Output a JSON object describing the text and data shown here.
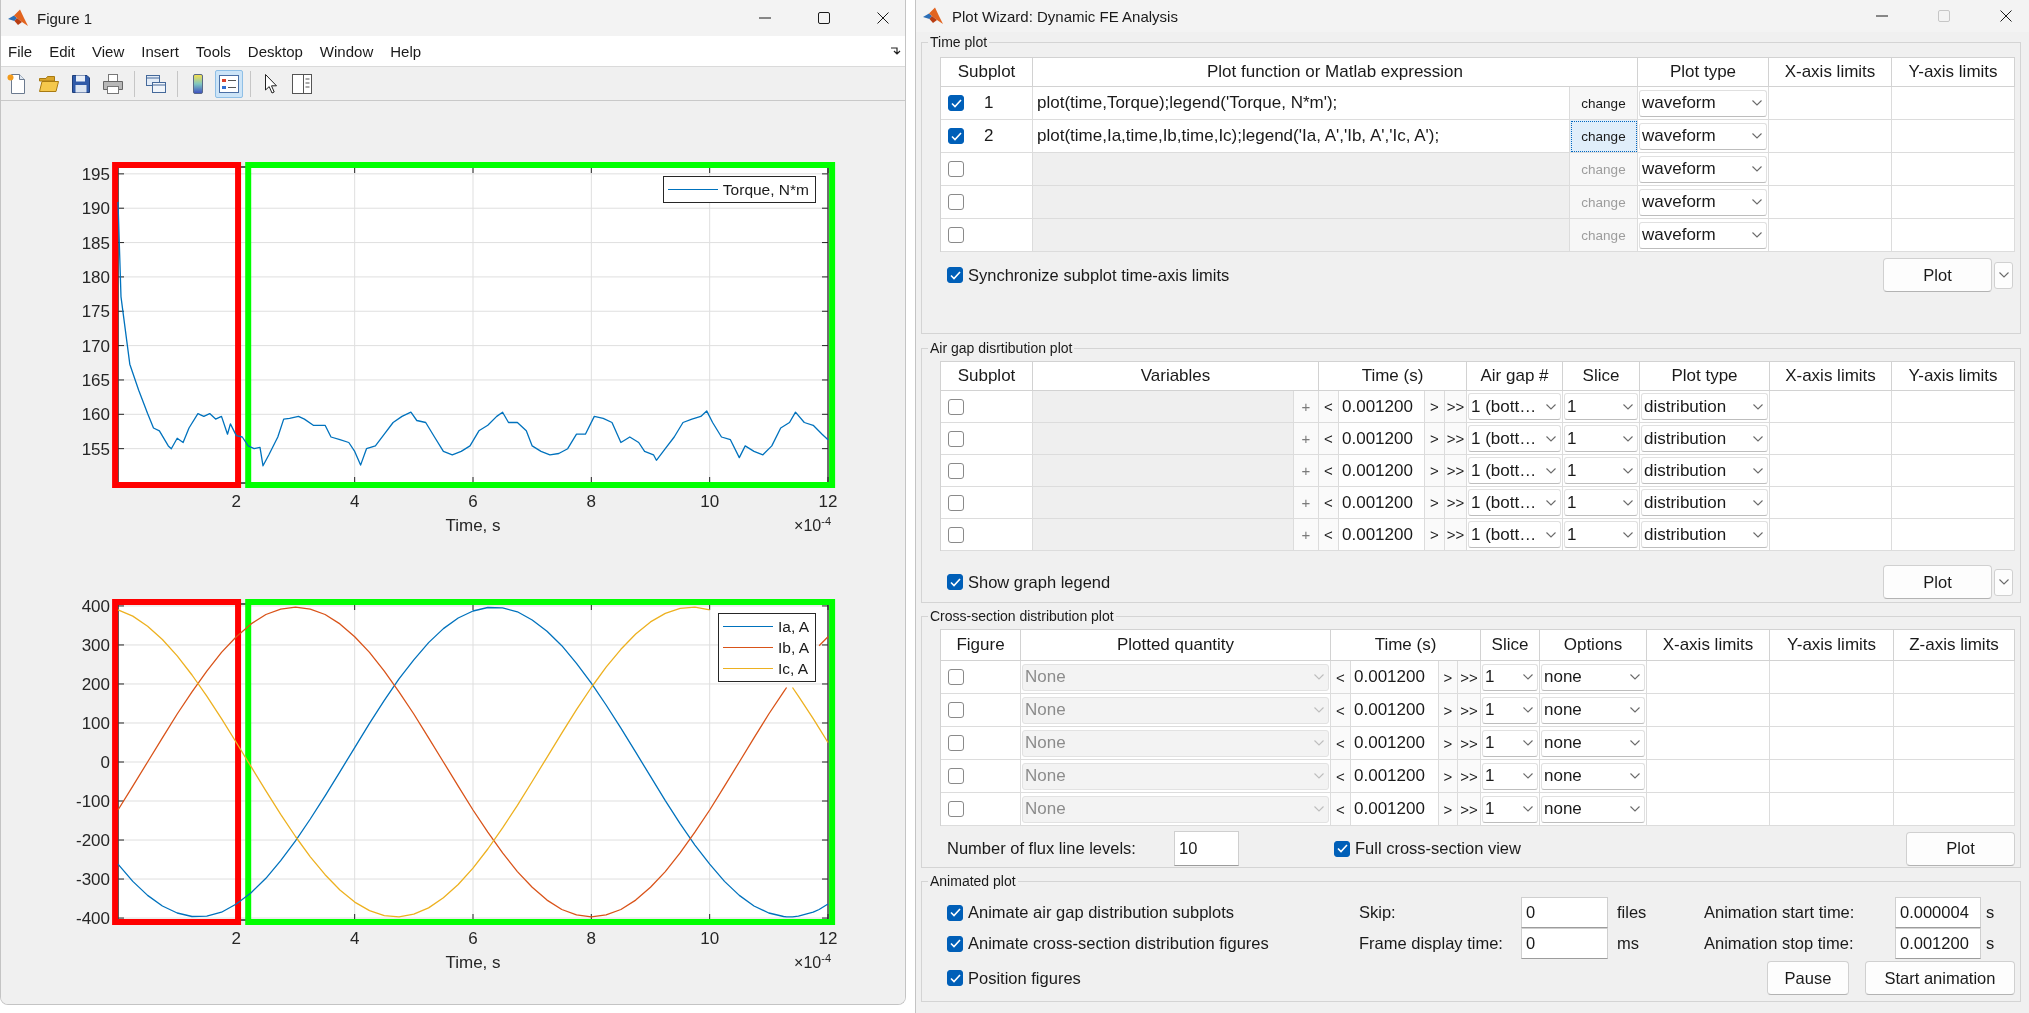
{
  "figure_window": {
    "title": "Figure 1",
    "window_controls": [
      {
        "kind": "minimize",
        "disabled": false
      },
      {
        "kind": "maximize",
        "disabled": false
      },
      {
        "kind": "close",
        "disabled": false
      }
    ],
    "menu": [
      "File",
      "Edit",
      "View",
      "Insert",
      "Tools",
      "Desktop",
      "Window",
      "Help"
    ],
    "toolbar": [
      [
        {
          "kind": "new",
          "selected": false
        },
        {
          "kind": "open",
          "selected": false
        },
        {
          "kind": "save",
          "selected": false
        },
        {
          "kind": "print",
          "selected": false
        }
      ],
      [
        {
          "kind": "link",
          "selected": false
        }
      ],
      [
        {
          "kind": "colorbar",
          "selected": false
        },
        {
          "kind": "legend",
          "selected": true
        }
      ],
      [
        {
          "kind": "pointer",
          "selected": false
        },
        {
          "kind": "inspector",
          "selected": false
        }
      ]
    ],
    "plots": [
      {
        "x_multiplier": "×10$^{-4}$",
        "highlights": [
          {
            "color": "#ff0000"
          },
          {
            "color": "#00ff00"
          }
        ],
        "chart_data": {
          "type": "line",
          "xlabel": "Time, s",
          "x": [
            0,
            0.05,
            0.2,
            0.35,
            0.5,
            0.6,
            0.7,
            0.85,
            0.9,
            1.0,
            1.1,
            1.2,
            1.35,
            1.45,
            1.55,
            1.65,
            1.75,
            1.85,
            1.9,
            2.0,
            2.1,
            2.2,
            2.3,
            2.4,
            2.45,
            2.55,
            2.7,
            2.8,
            2.9,
            3.05,
            3.15,
            3.3,
            3.5,
            3.6,
            3.75,
            3.9,
            4.0,
            4.1,
            4.2,
            4.35,
            4.5,
            4.65,
            4.8,
            4.95,
            5.05,
            5.2,
            5.35,
            5.5,
            5.65,
            5.8,
            5.95,
            6.1,
            6.25,
            6.4,
            6.5,
            6.6,
            6.75,
            6.9,
            7.0,
            7.15,
            7.3,
            7.45,
            7.6,
            7.75,
            7.9,
            8.05,
            8.2,
            8.35,
            8.5,
            8.65,
            8.8,
            8.9,
            9.05,
            9.1,
            9.25,
            9.4,
            9.55,
            9.7,
            9.85,
            9.95,
            10.05,
            10.2,
            10.35,
            10.5,
            10.6,
            10.75,
            10.9,
            11.05,
            11.2,
            11.35,
            11.45,
            11.6,
            11.75,
            11.9,
            12.0
          ],
          "series": [
            {
              "name": "Torque, N*m",
              "color": "#0072bd",
              "values": [
                190.9,
                177.1,
                167.3,
                163.5,
                160.1,
                158,
                157.6,
                155.4,
                155,
                156.5,
                155.9,
                158,
                160.1,
                159.7,
                160.1,
                159.3,
                159.7,
                157.1,
                158.6,
                156.9,
                156.7,
                155.4,
                155,
                155.2,
                152.5,
                154.1,
                156.7,
                159.3,
                159.4,
                159.7,
                159.3,
                158.4,
                158.4,
                156.7,
                156.3,
                155.9,
                154.6,
                152.6,
                155,
                155.4,
                157.1,
                158.8,
                159.7,
                160.3,
                159.1,
                158.8,
                156.7,
                154.6,
                154.1,
                154.6,
                155.4,
                157.6,
                158.4,
                159.7,
                160.3,
                158.8,
                158.8,
                157.6,
                155.4,
                154.6,
                154.1,
                154.3,
                155,
                157.1,
                157.1,
                159.7,
                159.4,
                158.8,
                155.9,
                156.7,
                155.9,
                154.6,
                154.1,
                153.3,
                155,
                156.7,
                158.8,
                159.3,
                159.7,
                160.5,
                158.8,
                156.7,
                156.3,
                153.7,
                155.4,
                154.6,
                154.1,
                155.4,
                158,
                158.8,
                160.3,
                158.8,
                158.4,
                157.1,
                156.3
              ]
            }
          ],
          "xlim": [
            0,
            12
          ],
          "ylim": [
            150,
            196
          ],
          "xticks": [
            2,
            4,
            6,
            8,
            10,
            12
          ],
          "yticks": [
            155,
            160,
            165,
            170,
            175,
            180,
            185,
            190,
            195
          ],
          "grid": true,
          "legend": "upper right"
        }
      },
      {
        "x_multiplier": "×10$^{-4}$",
        "highlights": [
          {
            "color": "#ff0000"
          },
          {
            "color": "#00ff00"
          }
        ],
        "chart_data": {
          "type": "line",
          "xlabel": "Time, s",
          "x": [
            0,
            0.25,
            0.5,
            0.75,
            1,
            1.25,
            1.5,
            1.75,
            2,
            2.25,
            2.5,
            2.75,
            3,
            3.25,
            3.5,
            3.75,
            4,
            4.25,
            4.5,
            4.75,
            5,
            5.25,
            5.5,
            5.75,
            6,
            6.25,
            6.5,
            6.75,
            7,
            7.25,
            7.5,
            7.75,
            8,
            8.25,
            8.5,
            8.75,
            9,
            9.25,
            9.5,
            9.75,
            10,
            10.25,
            10.5,
            10.75,
            11,
            11.25,
            11.3,
            11.4,
            11.5,
            11.75,
            11.85,
            12
          ],
          "series": [
            {
              "name": "Ia, A",
              "color": "#0072bd",
              "values": [
                -262,
                -306,
                -342,
                -369,
                -387,
                -396,
                -395,
                -385,
                -364,
                -335,
                -298,
                -253,
                -202,
                -146,
                -87,
                -25,
                37,
                99,
                158,
                213,
                262,
                306,
                342,
                369,
                387,
                396,
                395,
                385,
                364,
                335,
                298,
                253,
                202,
                146,
                87,
                25,
                -37,
                -99,
                -158,
                -213,
                -262,
                -306,
                -342,
                -369,
                -387,
                -396,
                -397,
                -397,
                -395,
                -385,
                -378,
                -364
              ]
            },
            {
              "name": "Ib, A",
              "color": "#d95319",
              "values": [
                -123,
                -62,
                0,
                62,
                123,
                180,
                233,
                281,
                321,
                354,
                378,
                392,
                397,
                392,
                378,
                354,
                321,
                281,
                233,
                180,
                123,
                62,
                0,
                -62,
                -123,
                -180,
                -233,
                -281,
                -321,
                -354,
                -378,
                -392,
                -397,
                -392,
                -378,
                -354,
                -321,
                -281,
                -233,
                -180,
                -123,
                -62,
                0,
                62,
                123,
                180,
                191,
                null,
                null,
                null,
                298,
                321
              ]
            },
            {
              "name": "Ic, A",
              "color": "#edb120",
              "values": [
                390,
                374,
                348,
                314,
                272,
                223,
                169,
                111,
                50,
                -12,
                -74,
                -134,
                -191,
                -243,
                -289,
                -328,
                -359,
                -381,
                -394,
                -397,
                -390,
                -374,
                -348,
                -314,
                -272,
                -223,
                -169,
                -111,
                -50,
                12,
                74,
                134,
                191,
                243,
                289,
                328,
                359,
                381,
                394,
                397,
                390,
                null,
                null,
                null,
                null,
                null,
                null,
                191,
                169,
                111,
                87,
                50
              ]
            }
          ],
          "xlim": [
            0,
            12
          ],
          "ylim": [
            -405,
            405
          ],
          "xticks": [
            2,
            4,
            6,
            8,
            10,
            12
          ],
          "yticks": [
            -400,
            -300,
            -200,
            -100,
            0,
            100,
            200,
            300,
            400
          ],
          "grid": true,
          "legend": "upper right"
        }
      }
    ]
  },
  "wizard_window": {
    "title": "Plot Wizard: Dynamic FE Analysis",
    "window_controls": [
      {
        "kind": "minimize",
        "disabled": false
      },
      {
        "kind": "maximize",
        "disabled": true
      },
      {
        "kind": "close",
        "disabled": false
      }
    ],
    "time_plot": {
      "title": "Time plot",
      "columns": [
        "Subplot",
        "Plot function or Matlab expression",
        "Plot type",
        "X-axis limits",
        "Y-axis limits"
      ],
      "rows": [
        {
          "checked": true,
          "subplot": "1",
          "expression": "plot(time,Torque);legend('Torque, N*m');",
          "disabled": false,
          "change": "change",
          "focused": false,
          "plot_type": "waveform"
        },
        {
          "checked": true,
          "subplot": "2",
          "expression": "plot(time,Ia,time,Ib,time,Ic);legend('Ia, A','Ib, A','Ic, A');",
          "disabled": false,
          "change": "change",
          "focused": true,
          "plot_type": "waveform"
        },
        {
          "checked": false,
          "disabled": true,
          "change": "change",
          "focused": false,
          "plot_type": "waveform"
        },
        {
          "checked": false,
          "disabled": true,
          "change": "change",
          "focused": false,
          "plot_type": "waveform"
        },
        {
          "checked": false,
          "disabled": true,
          "change": "change",
          "focused": false,
          "plot_type": "waveform"
        }
      ],
      "options": [
        {
          "label": "Synchronize subplot time-axis limits",
          "checked": true
        }
      ],
      "plot_button": "Plot"
    },
    "air_gap_plot": {
      "title": "Air gap disrtibution plot",
      "columns": [
        "Subplot",
        "Variables",
        "Time (s)",
        "Air gap #",
        "Slice",
        "Plot type",
        "X-axis limits",
        "Y-axis limits"
      ],
      "rows": [
        {
          "checked": false,
          "disabled": true,
          "plus": "+",
          "back": "<",
          "time": "0.001200",
          "forward": ">",
          "fast_forward": ">>",
          "air_gap": "1 (bott…",
          "slice": "1",
          "plot_type": "distribution"
        },
        {
          "checked": false,
          "disabled": true,
          "plus": "+",
          "back": "<",
          "time": "0.001200",
          "forward": ">",
          "fast_forward": ">>",
          "air_gap": "1 (bott…",
          "slice": "1",
          "plot_type": "distribution"
        },
        {
          "checked": false,
          "disabled": true,
          "plus": "+",
          "back": "<",
          "time": "0.001200",
          "forward": ">",
          "fast_forward": ">>",
          "air_gap": "1 (bott…",
          "slice": "1",
          "plot_type": "distribution"
        },
        {
          "checked": false,
          "disabled": true,
          "plus": "+",
          "back": "<",
          "time": "0.001200",
          "forward": ">",
          "fast_forward": ">>",
          "air_gap": "1 (bott…",
          "slice": "1",
          "plot_type": "distribution"
        },
        {
          "checked": false,
          "disabled": true,
          "plus": "+",
          "back": "<",
          "time": "0.001200",
          "forward": ">",
          "fast_forward": ">>",
          "air_gap": "1 (bott…",
          "slice": "1",
          "plot_type": "distribution"
        }
      ],
      "options": [
        {
          "label": "Show graph legend",
          "checked": true
        }
      ],
      "plot_button": "Plot"
    },
    "cross_section_plot": {
      "title": "Cross-section distribution plot",
      "columns": [
        "Figure",
        "Plotted quantity",
        "Time (s)",
        "Slice",
        "Options",
        "X-axis limits",
        "Y-axis limits",
        "Z-axis limits"
      ],
      "rows": [
        {
          "checked": false,
          "disabled": true,
          "quantity": "None",
          "back": "<",
          "time": "0.001200",
          "forward": ">",
          "fast_forward": ">>",
          "slice": "1",
          "options": "none"
        },
        {
          "checked": false,
          "disabled": true,
          "quantity": "None",
          "back": "<",
          "time": "0.001200",
          "forward": ">",
          "fast_forward": ">>",
          "slice": "1",
          "options": "none"
        },
        {
          "checked": false,
          "disabled": true,
          "quantity": "None",
          "back": "<",
          "time": "0.001200",
          "forward": ">",
          "fast_forward": ">>",
          "slice": "1",
          "options": "none"
        },
        {
          "checked": false,
          "disabled": true,
          "quantity": "None",
          "back": "<",
          "time": "0.001200",
          "forward": ">",
          "fast_forward": ">>",
          "slice": "1",
          "options": "none"
        },
        {
          "checked": false,
          "disabled": true,
          "quantity": "None",
          "back": "<",
          "time": "0.001200",
          "forward": ">",
          "fast_forward": ">>",
          "slice": "1",
          "options": "none"
        }
      ],
      "flux_levels": {
        "label": "Number of flux line levels:",
        "value": "10"
      },
      "full_view": {
        "label": "Full cross-section view",
        "checked": true
      },
      "plot_button": "Plot"
    },
    "animated_plot": {
      "title": "Animated plot",
      "checkboxes": [
        {
          "label": "Animate air gap distribution subplots",
          "checked": true
        },
        {
          "label": "Animate cross-section distribution figures",
          "checked": true
        },
        {
          "label": "Position figures",
          "checked": true
        }
      ],
      "fields": [
        {
          "label": "Skip:",
          "value": "0",
          "unit": "files"
        },
        {
          "label": "Animation start time:",
          "value": "0.000004",
          "unit": "s"
        },
        {
          "label": "Frame display time:",
          "value": "0",
          "unit": "ms"
        },
        {
          "label": "Animation stop time:",
          "value": "0.001200",
          "unit": "s"
        }
      ],
      "buttons": [
        "Pause",
        "Start animation"
      ]
    }
  }
}
